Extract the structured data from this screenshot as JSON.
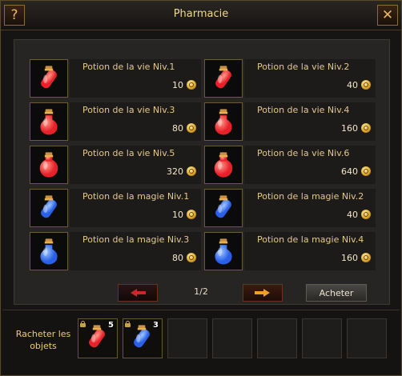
{
  "window": {
    "title": "Pharmacie",
    "help_label": "?",
    "close_label": "✕"
  },
  "shop": {
    "items": [
      {
        "name": "Potion de la vie Niv.1",
        "price": "10",
        "icon": "red-potion-vial-icon"
      },
      {
        "name": "Potion de la vie Niv.2",
        "price": "40",
        "icon": "red-potion-flask-icon"
      },
      {
        "name": "Potion de la vie Niv.3",
        "price": "80",
        "icon": "red-potion-bottle-icon"
      },
      {
        "name": "Potion de la vie Niv.4",
        "price": "160",
        "icon": "red-potion-round-icon"
      },
      {
        "name": "Potion de la vie Niv.5",
        "price": "320",
        "icon": "red-potion-large-icon"
      },
      {
        "name": "Potion de la vie Niv.6",
        "price": "640",
        "icon": "red-potion-ornate-icon"
      },
      {
        "name": "Potion de la magie Niv.1",
        "price": "10",
        "icon": "blue-potion-vial-icon"
      },
      {
        "name": "Potion de la magie Niv.2",
        "price": "40",
        "icon": "blue-potion-flask-icon"
      },
      {
        "name": "Potion de la magie Niv.3",
        "price": "80",
        "icon": "blue-potion-bottle-icon"
      },
      {
        "name": "Potion de la magie Niv.4",
        "price": "160",
        "icon": "blue-potion-round-icon"
      }
    ],
    "currency_icon": "gold-coin-icon"
  },
  "pagination": {
    "page": "1/2",
    "prev_icon": "arrow-left-icon",
    "next_icon": "arrow-right-icon"
  },
  "buy_button": {
    "label": "Acheter"
  },
  "buyback": {
    "label": "Racheter les objets",
    "slots": [
      {
        "icon": "red-potion-icon",
        "count": "5"
      },
      {
        "icon": "blue-potion-icon",
        "count": "3"
      }
    ]
  },
  "colors": {
    "accent": "#f0cc68",
    "name_text": "#e5c88c",
    "red_potion": "#e8202a",
    "blue_potion": "#2a60e8"
  }
}
